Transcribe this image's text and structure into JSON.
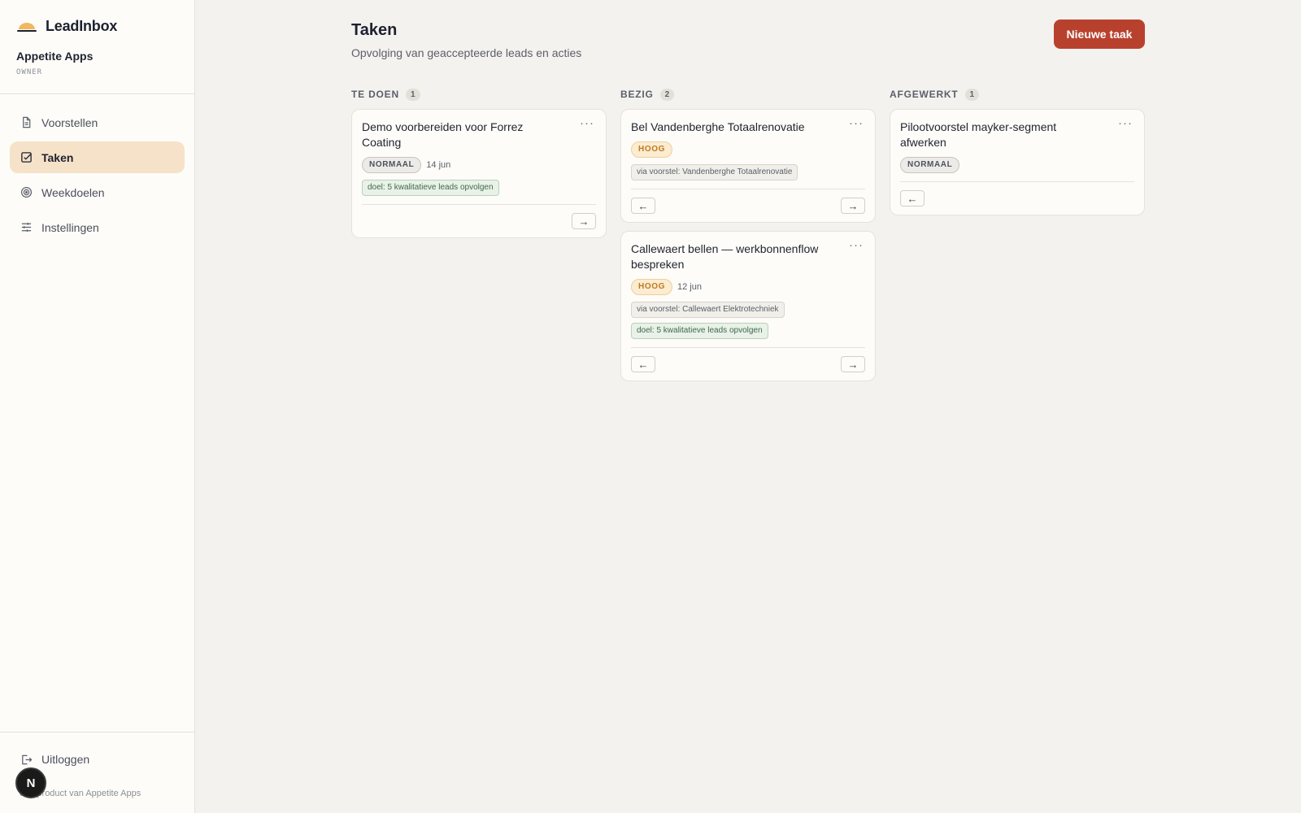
{
  "app": {
    "brand_name": "LeadInbox",
    "org_name": "Appetite Apps",
    "org_role": "OWNER",
    "avatar_letter": "N",
    "footer": "een product van Appetite Apps",
    "accent": "#b8412e",
    "active_nav_bg": "#f6e2c8"
  },
  "sidebar": {
    "items": [
      {
        "label": "Voorstellen",
        "icon": "document-icon",
        "active": false
      },
      {
        "label": "Taken",
        "icon": "checkbox-icon",
        "active": true
      },
      {
        "label": "Weekdoelen",
        "icon": "target-icon",
        "active": false
      },
      {
        "label": "Instellingen",
        "icon": "sliders-icon",
        "active": false
      }
    ],
    "logout_label": "Uitloggen"
  },
  "header": {
    "title": "Taken",
    "subtitle": "Opvolging van geaccepteerde leads en acties",
    "new_task_label": "Nieuwe taak"
  },
  "board": {
    "columns": [
      {
        "title": "TE DOEN",
        "count": "1",
        "cards": [
          {
            "title": "Demo voorbereiden voor Forrez Coating",
            "priority": "NORMAAL",
            "priority_level": "normaal",
            "due": "14 jun",
            "via": "",
            "goal": "doel: 5 kwalitatieve leads opvolgen",
            "left_arrow": "",
            "right_arrow": "→"
          }
        ]
      },
      {
        "title": "BEZIG",
        "count": "2",
        "cards": [
          {
            "title": "Bel Vandenberghe Totaalrenovatie",
            "priority": "HOOG",
            "priority_level": "hoog",
            "due": "",
            "via": "via voorstel: Vandenberghe Totaalrenovatie",
            "goal": "",
            "left_arrow": "←",
            "right_arrow": "→"
          },
          {
            "title": "Callewaert bellen — werkbonnenflow bespreken",
            "priority": "HOOG",
            "priority_level": "hoog",
            "due": "12 jun",
            "via": "via voorstel: Callewaert Elektrotechniek",
            "goal": "doel: 5 kwalitatieve leads opvolgen",
            "left_arrow": "←",
            "right_arrow": "→"
          }
        ]
      },
      {
        "title": "AFGEWERKT",
        "count": "1",
        "cards": [
          {
            "title": "Pilootvoorstel mayker-segment afwerken",
            "priority": "NORMAAL",
            "priority_level": "normaal",
            "due": "",
            "via": "",
            "goal": "",
            "left_arrow": "←",
            "right_arrow": ""
          }
        ]
      }
    ]
  }
}
